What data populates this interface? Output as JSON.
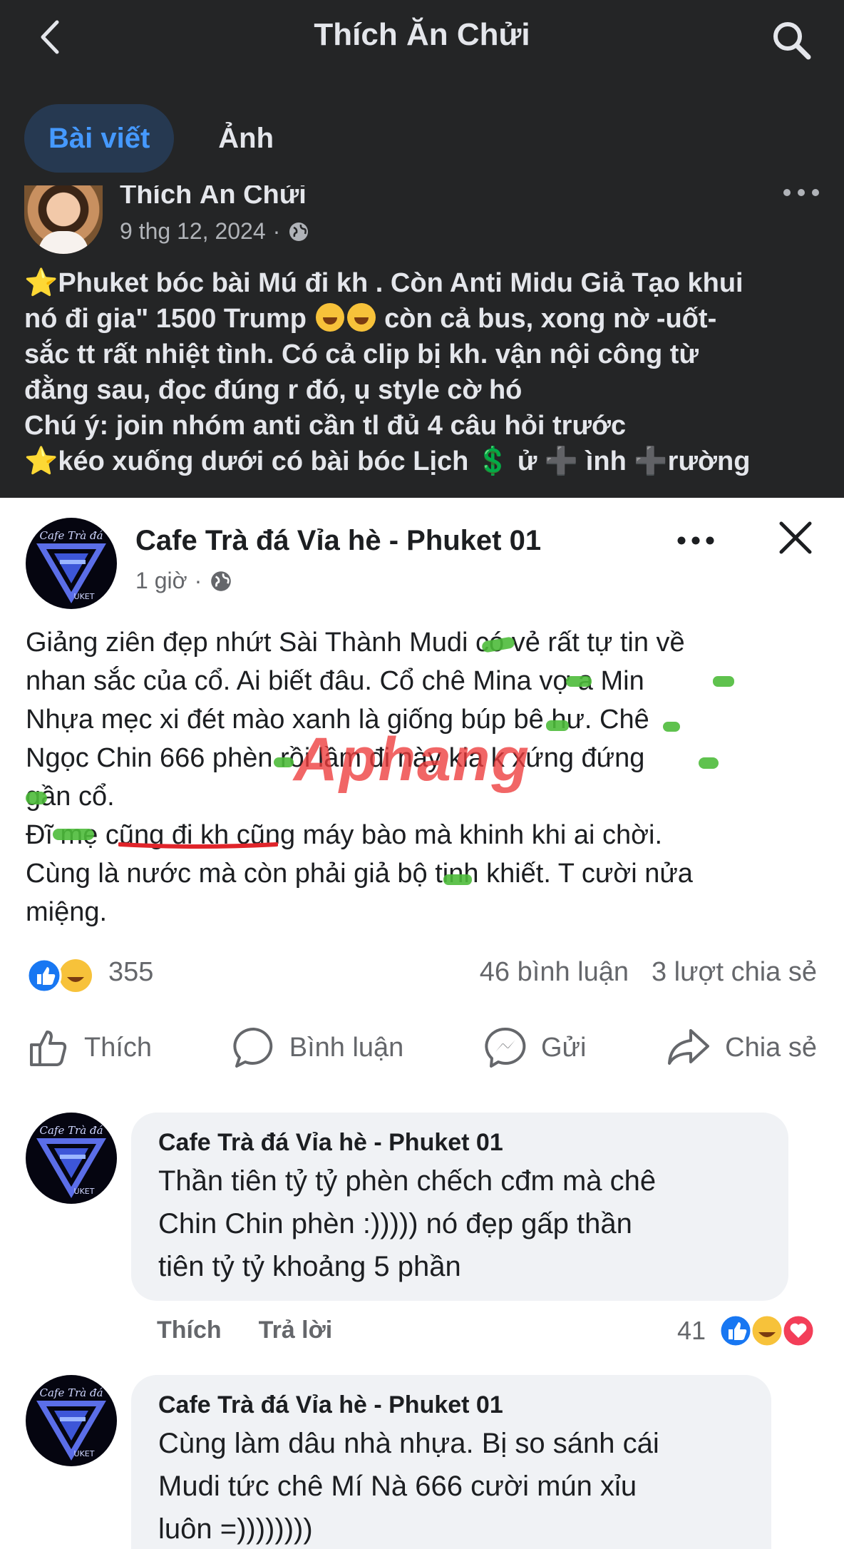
{
  "header": {
    "title": "Thích Ăn Chửi"
  },
  "tabs": [
    {
      "label": "Bài viết",
      "active": true
    },
    {
      "label": "Ảnh",
      "active": false
    }
  ],
  "post": {
    "author": "Thích Ăn Chửi",
    "date": "9 thg 12, 2024",
    "date_sep": "·",
    "lines": [
      "Phuket bóc bài Mú đi kh . Còn Anti Midu Giả Tạo khui",
      "nó đi gia\"  1500 Trump",
      "còn cả bus, xong nờ -uốt-",
      "sắc tt rất nhiệt tình. Có cả clip bị kh. vận nội công từ",
      "đằng sau, đọc đúng r đó, ụ style cờ hó",
      "Chú ý: join nhóm anti cần tl đủ 4 câu hỏi trước",
      "kéo xuống dưới có bài bóc Lịch",
      "ử",
      "ình",
      "rường"
    ],
    "symbols": {
      "star": "⭐",
      "dollar": "💲",
      "plus": "➕"
    }
  },
  "shared": {
    "group_name": "Cafe Trà đá Vỉa hè - Phuket 01",
    "time": "1 giờ",
    "time_sep": "·",
    "lines": [
      "Giảng ziên đẹp nhứt Sài Thành Mudi có vẻ rất tự tin về",
      "nhan sắc của cổ. Ai biết đâu. Cổ chê Mina vợ a Min",
      "Nhựa mẹc xi đét mào xanh là giống búp bê hư. Chê",
      "Ngọc Chin 666 phèn rồi lầm đi này kia k xứng đứng",
      "gần cổ.",
      "Đĩ mẹ cũng đi kh cũng máy bào mà khinh khi ai chời.",
      "Cùng là nước mà còn phải giả bộ tinh khiết. T cười nửa",
      "miệng."
    ],
    "reaction_count": "355",
    "comments_count": "46 bình luận",
    "shares_count": "3 lượt chia sẻ",
    "actions": {
      "like": "Thích",
      "comment": "Bình luận",
      "send": "Gửi",
      "share": "Chia sẻ"
    },
    "watermark": {
      "part1": "Aphang",
      "part2": "ng"
    },
    "logo_text": "Cafe Trà đá",
    "logo_sub": "UKET"
  },
  "comments": [
    {
      "name": "Cafe Trà đá Vỉa hè - Phuket 01",
      "lines": [
        "Thần tiên tỷ tỷ phèn chếch cđm mà chê",
        "Chin Chin phèn :))))) nó đẹp gấp thần",
        "tiên tỷ tỷ khoảng 5 phần"
      ],
      "like": "Thích",
      "reply": "Trả lời",
      "count": "41"
    },
    {
      "name": "Cafe Trà đá Vỉa hè - Phuket 01",
      "lines": [
        "Cùng làm dâu nhà nhựa. Bị so sánh cái",
        "Mudi tức chê Mí Nà 666 cười mún xỉu",
        "luôn =))))))))"
      ]
    }
  ],
  "colors": {
    "dark_bg": "#242526",
    "tab_active_bg": "#263951",
    "tab_active_text": "#4599ff",
    "fb_blue": "#1877f2",
    "red_underline": "#e0242a"
  }
}
